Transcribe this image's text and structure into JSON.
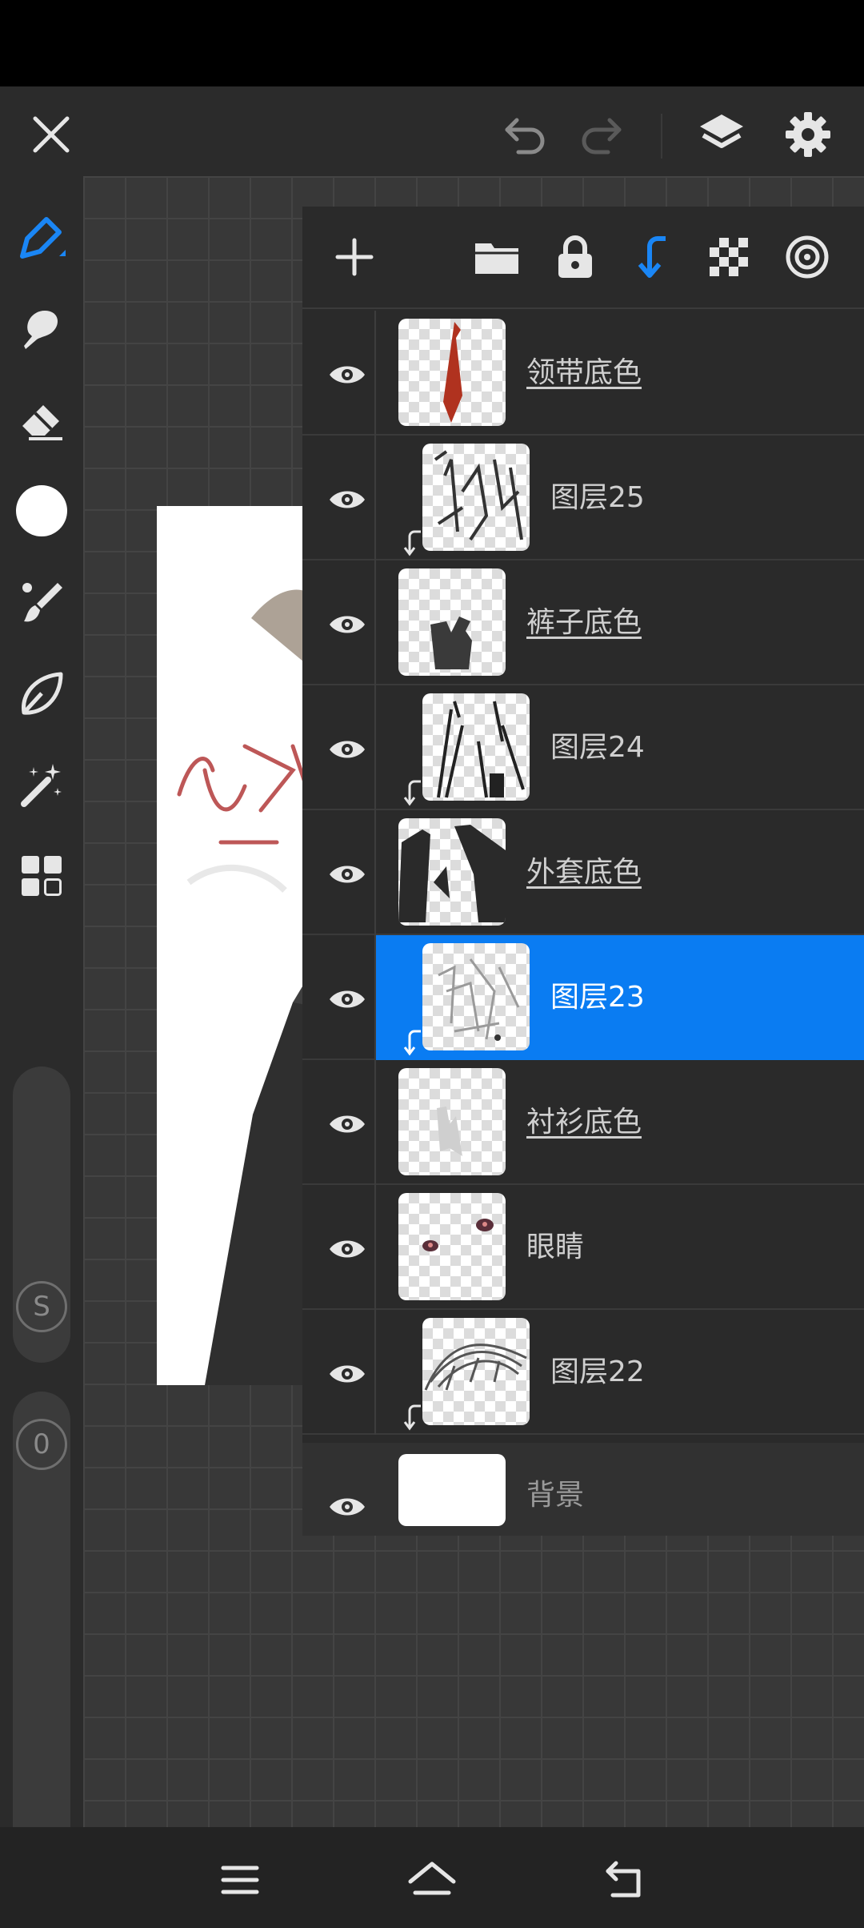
{
  "icons": {
    "close": "close-icon",
    "undo": "undo-icon",
    "redo": "redo-icon",
    "layers": "layers-icon",
    "settings": "gear-icon"
  },
  "toolbar": {
    "tools": [
      "pen-tool-icon",
      "smudge-icon",
      "eraser-icon",
      "color-swatch",
      "brush-icon",
      "shape-icon",
      "magic-wand-icon",
      "gallery-icon"
    ],
    "brush_size_badge": "S",
    "opacity_badge": "0"
  },
  "layer_panel": {
    "header_buttons": [
      "add-layer-icon",
      "folder-icon",
      "lock-icon",
      "clip-icon",
      "alpha-lock-icon",
      "blend-icon"
    ],
    "layers": [
      {
        "name": "领带底色",
        "clipped": false,
        "underline": true,
        "selected": false
      },
      {
        "name": "图层25",
        "clipped": true,
        "underline": false,
        "selected": false
      },
      {
        "name": "裤子底色",
        "clipped": false,
        "underline": true,
        "selected": false
      },
      {
        "name": "图层24",
        "clipped": true,
        "underline": false,
        "selected": false
      },
      {
        "name": "外套底色",
        "clipped": false,
        "underline": true,
        "selected": false
      },
      {
        "name": "图层23",
        "clipped": true,
        "underline": false,
        "selected": true
      },
      {
        "name": "衬衫底色",
        "clipped": false,
        "underline": true,
        "selected": false
      },
      {
        "name": "眼睛",
        "clipped": false,
        "underline": false,
        "selected": false
      },
      {
        "name": "图层22",
        "clipped": true,
        "underline": false,
        "selected": false
      }
    ],
    "background_layer": {
      "name": "背景"
    }
  },
  "colors": {
    "accent": "#0a7cf2",
    "panel": "#2a2a2a",
    "toolbar": "#2b2b2b"
  }
}
